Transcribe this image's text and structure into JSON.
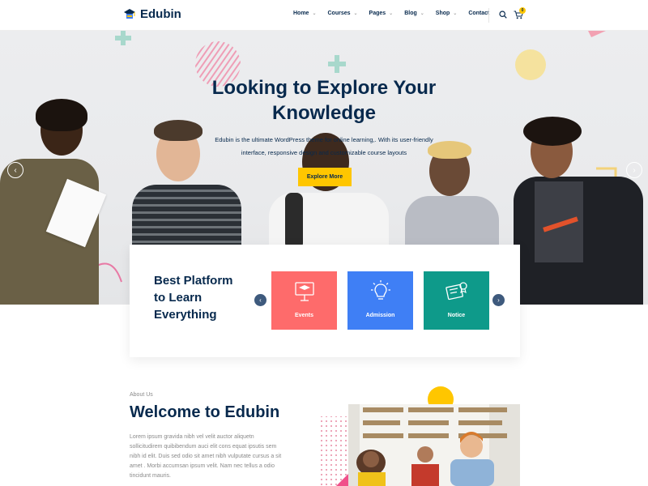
{
  "brand": {
    "name": "Edubin"
  },
  "nav": {
    "items": [
      {
        "label": "Home",
        "has_dropdown": true
      },
      {
        "label": "Courses",
        "has_dropdown": true
      },
      {
        "label": "Pages",
        "has_dropdown": true
      },
      {
        "label": "Blog",
        "has_dropdown": true
      },
      {
        "label": "Shop",
        "has_dropdown": true
      },
      {
        "label": "Contact",
        "has_dropdown": false
      }
    ],
    "cart_count": "0",
    "search_icon": "search-icon",
    "cart_icon": "cart-icon"
  },
  "hero": {
    "title_line1": "Looking to Explore Your",
    "title_line2": "Knowledge",
    "desc_line1": "Edubin is the ultimate WordPress theme for online learning,. With its user-friendly",
    "desc_line2": "interface, responsive design and customizable course layouts",
    "cta_label": "Explore More",
    "prev_icon": "chevron-left-icon",
    "next_icon": "chevron-right-icon"
  },
  "platform": {
    "title_line1": "Best Platform",
    "title_line2": "to Learn",
    "title_line3": "Everything",
    "features": [
      {
        "label": "Events",
        "color": "#fe6b6b",
        "icon": "presentation-icon"
      },
      {
        "label": "Admission",
        "color": "#3f7ff5",
        "icon": "lightbulb-icon"
      },
      {
        "label": "Notice",
        "color": "#0e9a8a",
        "icon": "certificate-icon"
      }
    ]
  },
  "about": {
    "eyebrow": "About Us",
    "title": "Welcome to Edubin",
    "text": "Lorem ipsum gravida nibh vel velit auctor aliquetn sollicitudirem quibibendum auci elit cons equat ipsutis sem nibh id elit. Duis sed odio sit amet nibh vulputate cursus a sit amet . Morbi accumsan ipsum velit. Nam nec tellus a odio tincidunt mauris."
  },
  "colors": {
    "primary": "#07294d",
    "accent": "#ffc600"
  }
}
